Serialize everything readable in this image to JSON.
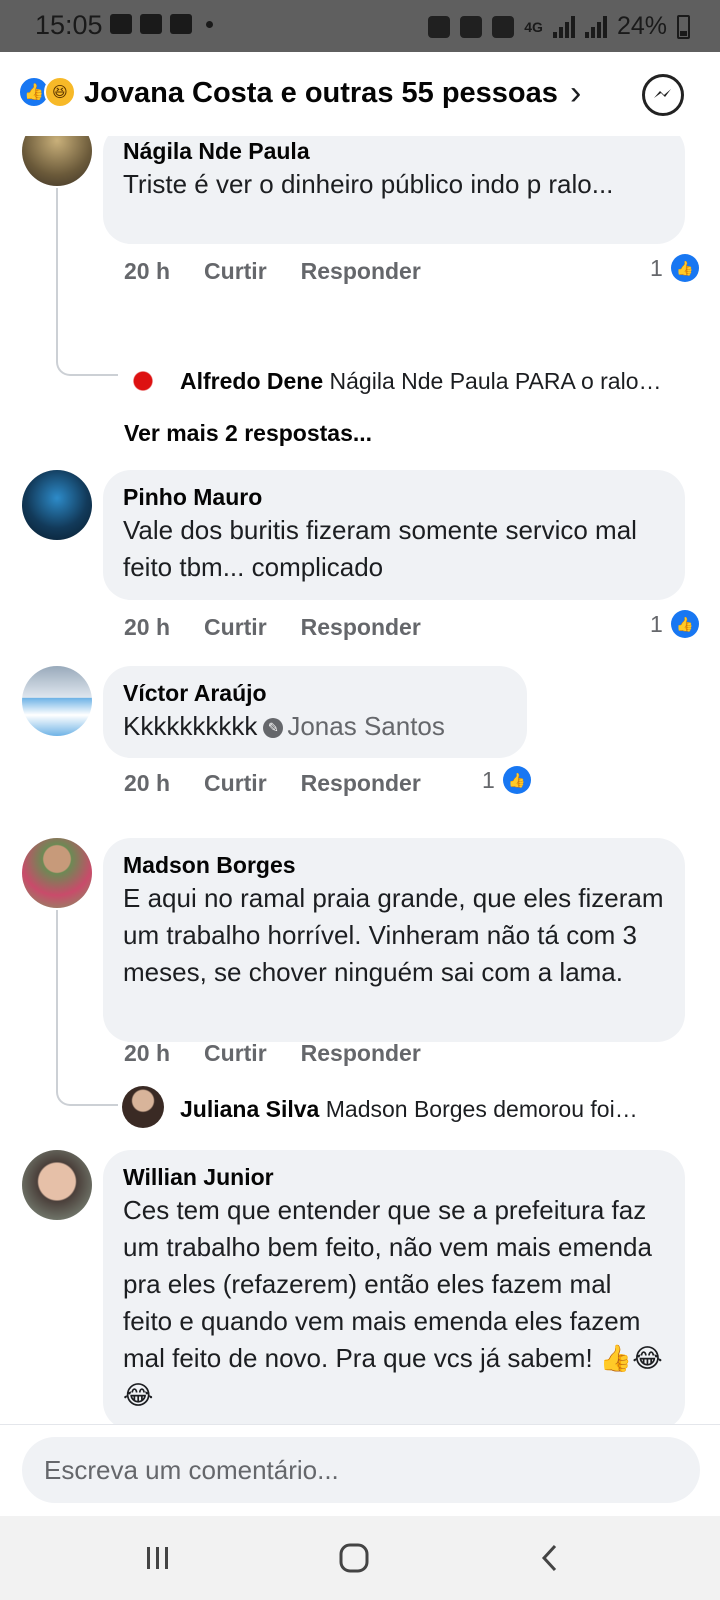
{
  "status_bar": {
    "time": "15:05",
    "battery": "24%",
    "network": "4G",
    "icons": [
      "gallery-icon",
      "gmail-icon",
      "voicemail-icon",
      "key-icon",
      "alarm-icon",
      "mute-icon",
      "volte-icon",
      "signal-icon",
      "battery-icon"
    ]
  },
  "header": {
    "title": "Jovana Costa e outras 55 pessoas",
    "chevron": "›",
    "reactions": [
      "like-icon",
      "haha-icon"
    ]
  },
  "comments": [
    {
      "name": "Nágila Nde Paula",
      "text": "Triste é ver o dinheiro público indo p ralo...",
      "time": "20 h",
      "like_label": "Curtir",
      "reply_label": "Responder",
      "likes": "1",
      "reply_preview": {
        "name": "Alfredo Dene",
        "text": "Nágila Nde Paula PARA o ralo…"
      },
      "more_replies": "Ver mais 2 respostas..."
    },
    {
      "name": "Pinho Mauro",
      "text": "Vale dos buritis fizeram somente servico mal feito tbm... complicado",
      "time": "20 h",
      "like_label": "Curtir",
      "reply_label": "Responder",
      "likes": "1"
    },
    {
      "name": "Víctor Araújo",
      "text": "Kkkkkkkkkk",
      "mention": "Jonas Santos",
      "time": "20 h",
      "like_label": "Curtir",
      "reply_label": "Responder",
      "likes": "1"
    },
    {
      "name": "Madson Borges",
      "text": "E aqui no ramal praia grande, que eles fizeram um trabalho horrível. Vinheram não tá com 3 meses, se chover ninguém sai com a lama.",
      "time": "20 h",
      "like_label": "Curtir",
      "reply_label": "Responder",
      "reply_preview": {
        "name": "Juliana Silva",
        "text": "Madson Borges  demorou foi…"
      }
    },
    {
      "name": "Willian Junior",
      "text": "Ces tem que entender que se a prefeitura faz um trabalho bem feito, não vem mais emenda pra eles (refazerem) então eles fazem mal feito e quando vem mais emenda eles fazem mal feito de novo. Pra que vcs já sabem! 👍😂😂"
    }
  ],
  "composer": {
    "placeholder": "Escreva um comentário..."
  },
  "nav": [
    "recent-apps-icon",
    "home-icon",
    "back-icon"
  ],
  "colors": {
    "facebook_blue": "#1877f2",
    "bubble": "#f0f2f5",
    "meta_gray": "#65676b"
  }
}
